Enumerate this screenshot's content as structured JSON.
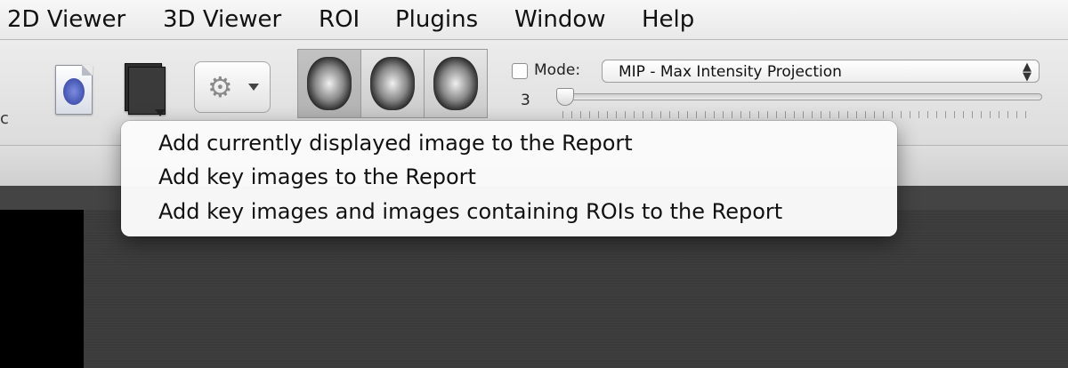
{
  "menubar": {
    "items": [
      "2D Viewer",
      "3D Viewer",
      "ROI",
      "Plugins",
      "Window",
      "Help"
    ]
  },
  "toolbar": {
    "edge_text": "c",
    "icons": [
      "report-document-icon",
      "key-images-icon",
      "gear-icon",
      "axial-view-icon",
      "coronal-view-icon",
      "sagittal-view-icon"
    ],
    "mode_label": "Mode:",
    "mode_checked": false,
    "mode_value": "MIP - Max Intensity Projection",
    "slider_value": "3"
  },
  "popup_menu": {
    "items": [
      "Add currently displayed image to the Report",
      "Add key images to the Report",
      "Add key images and images containing ROIs to the Report"
    ]
  }
}
